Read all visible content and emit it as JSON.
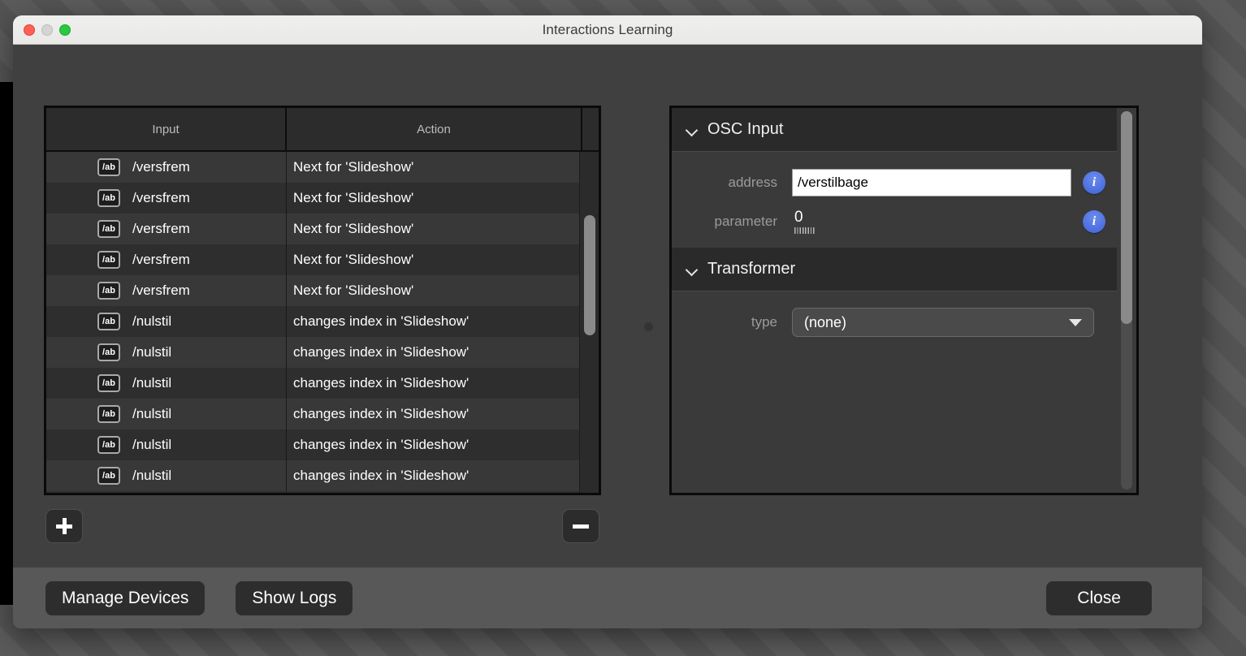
{
  "window": {
    "title": "Interactions Learning",
    "controls": {
      "close": "close-button",
      "minimize": "minimize-button",
      "maximize": "maximize-button"
    }
  },
  "table": {
    "columns": [
      "Input",
      "Action"
    ],
    "row_icon_label": "/ab",
    "rows": [
      {
        "icon": "/ab",
        "input": "/versfrem",
        "action": "Next for 'Slideshow'"
      },
      {
        "icon": "/ab",
        "input": "/versfrem",
        "action": "Next for 'Slideshow'"
      },
      {
        "icon": "/ab",
        "input": "/versfrem",
        "action": "Next for 'Slideshow'"
      },
      {
        "icon": "/ab",
        "input": "/versfrem",
        "action": "Next for 'Slideshow'"
      },
      {
        "icon": "/ab",
        "input": "/versfrem",
        "action": "Next for 'Slideshow'"
      },
      {
        "icon": "/ab",
        "input": "/nulstil",
        "action": "changes index in 'Slideshow'"
      },
      {
        "icon": "/ab",
        "input": "/nulstil",
        "action": "changes index in 'Slideshow'"
      },
      {
        "icon": "/ab",
        "input": "/nulstil",
        "action": "changes index in 'Slideshow'"
      },
      {
        "icon": "/ab",
        "input": "/nulstil",
        "action": "changes index in 'Slideshow'"
      },
      {
        "icon": "/ab",
        "input": "/nulstil",
        "action": "changes index in 'Slideshow'"
      },
      {
        "icon": "/ab",
        "input": "/nulstil",
        "action": "changes index in 'Slideshow'"
      }
    ]
  },
  "list_controls": {
    "add_label": "+",
    "remove_label": "−"
  },
  "inspector": {
    "osc_input": {
      "title": "OSC Input",
      "address_label": "address",
      "address_value": "/verstilbage",
      "address_placeholder": "",
      "parameter_label": "parameter",
      "parameter_value": "0",
      "info_label": "i"
    },
    "transformer": {
      "title": "Transformer",
      "type_label": "type",
      "type_value": "(none)"
    }
  },
  "footer": {
    "manage_devices": "Manage Devices",
    "show_logs": "Show Logs",
    "close": "Close"
  },
  "colors": {
    "accent_info": "#4a6fe0",
    "window_chrome": "#efefed",
    "panel_bg": "#3a3a3a",
    "table_bg": "#2e2e2e",
    "footer_bg": "#585858"
  }
}
